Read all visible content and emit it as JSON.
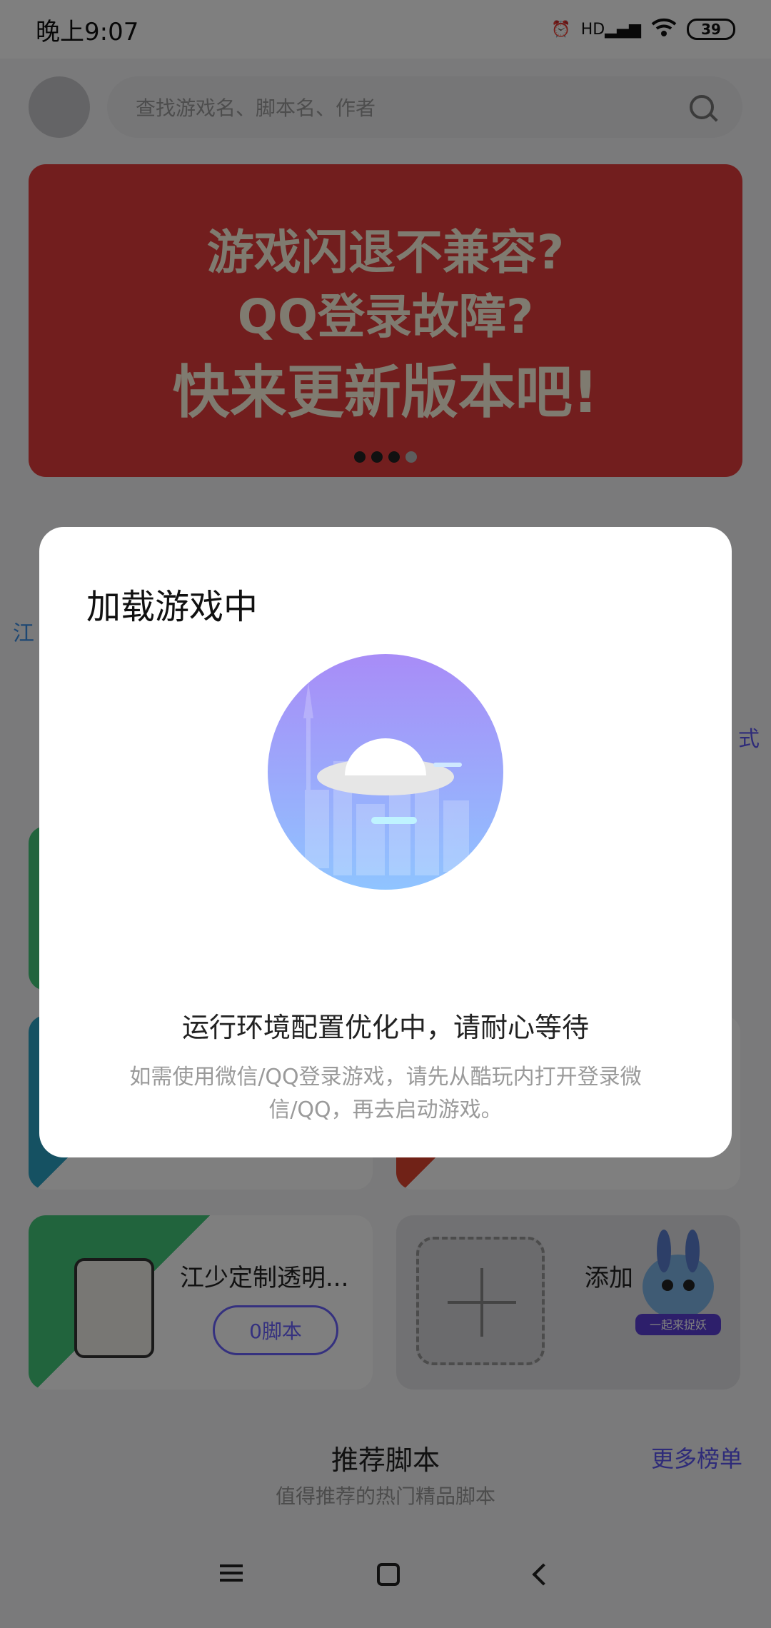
{
  "status_bar": {
    "time": "晚上9:07",
    "network_label": "HD",
    "battery": "39"
  },
  "search": {
    "placeholder": "查找游戏名、脚本名、作者"
  },
  "banner": {
    "line1": "游戏闪退不兼容?",
    "line2": "QQ登录故障?",
    "line3": "快来更新版本吧!",
    "slide_count": 4,
    "active_slide": 4
  },
  "side_labels": {
    "left": "江",
    "right": "式"
  },
  "cards": [
    {
      "title": "江少定制透明...",
      "button": "0脚本",
      "icon": "bag-icon"
    },
    {
      "title": "添加",
      "icon": "plus-icon"
    }
  ],
  "mascot_caption": "一起来捉妖",
  "recommend": {
    "title": "推荐脚本",
    "subtitle": "值得推荐的热门精品脚本",
    "more": "更多榜单"
  },
  "dialog": {
    "title": "加载游戏中",
    "illustration": "ufo-icon",
    "message": "运行环境配置优化中，请耐心等待",
    "note": "如需使用微信/QQ登录游戏，请先从酷玩内打开登录微信/QQ，再去启动游戏。"
  },
  "navbar": {
    "menu_icon": "menu-icon",
    "home_icon": "home-icon",
    "back_icon": "back-icon"
  },
  "colors": {
    "accent": "#6a63ff",
    "banner": "#e43c3c",
    "overlay": "rgba(0,0,0,0.5)"
  }
}
